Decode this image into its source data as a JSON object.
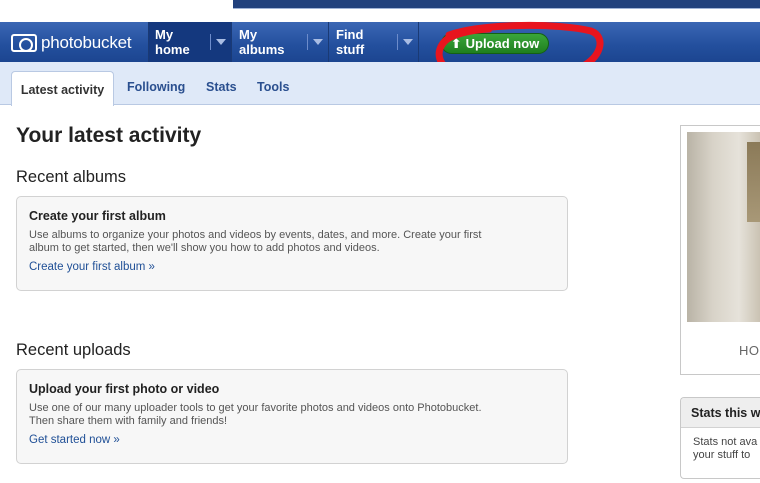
{
  "brand": {
    "logo_text": "photobucket"
  },
  "nav": {
    "tabs": [
      {
        "label": "My home"
      },
      {
        "label": "My albums"
      },
      {
        "label": "Find stuff"
      }
    ],
    "upload_label": "Upload now"
  },
  "subnav": {
    "tabs": [
      {
        "label": "Latest activity"
      },
      {
        "label": "Following"
      },
      {
        "label": "Stats"
      },
      {
        "label": "Tools"
      }
    ]
  },
  "main": {
    "title": "Your latest activity",
    "recent_albums": {
      "heading": "Recent albums",
      "card_title": "Create your first album",
      "card_desc_1": "Use albums to organize your photos and videos by events, dates, and more. Create your first",
      "card_desc_2": "album to get started, then we'll show you how to add photos and videos.",
      "card_link": "Create your first album »"
    },
    "recent_uploads": {
      "heading": "Recent uploads",
      "card_title": "Upload your first photo or video",
      "card_desc_1": "Use one of our many uploader tools to get your favorite photos and videos onto Photobucket.",
      "card_desc_2": "Then share them with family and friends!",
      "card_link": "Get started now »"
    }
  },
  "sidebar": {
    "promo_caption": "HO",
    "stats_heading": "Stats this w",
    "stats_text_1": "Stats not ava",
    "stats_text_2": "your stuff to"
  },
  "colors": {
    "nav_blue": "#234f9d",
    "upload_green": "#2a952a",
    "annotation_red": "#e8141e",
    "link_blue": "#1f4f96"
  }
}
